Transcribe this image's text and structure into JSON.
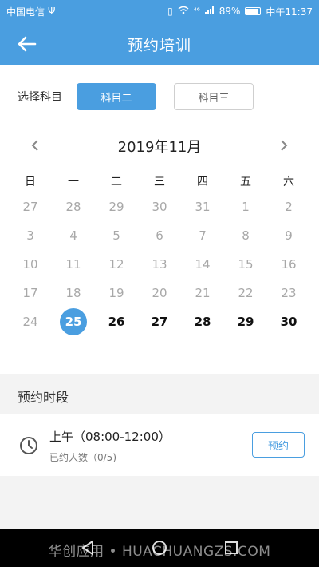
{
  "status_bar": {
    "carrier": "中国电信",
    "usb": "Ψ",
    "signal": "⁴⁶",
    "battery": "89%",
    "time": "中午11:37"
  },
  "header": {
    "title": "预约培训",
    "back_icon": "arrow-left-icon"
  },
  "subject": {
    "label": "选择科目",
    "options": [
      "科目二",
      "科目三"
    ],
    "selected": "科目二"
  },
  "calendar": {
    "month_title": "2019年11月",
    "weekdays": [
      "日",
      "一",
      "二",
      "三",
      "四",
      "五",
      "六"
    ],
    "weeks": [
      [
        "27",
        "28",
        "29",
        "30",
        "31",
        "1",
        "2"
      ],
      [
        "3",
        "4",
        "5",
        "6",
        "7",
        "8",
        "9"
      ],
      [
        "10",
        "11",
        "12",
        "13",
        "14",
        "15",
        "16"
      ],
      [
        "17",
        "18",
        "19",
        "20",
        "21",
        "22",
        "23"
      ],
      [
        "24",
        "25",
        "26",
        "27",
        "28",
        "29",
        "30"
      ]
    ],
    "selected_day": "25",
    "bookable_days": [
      "26",
      "27",
      "28",
      "29",
      "30"
    ]
  },
  "slots_section": {
    "title": "预约时段",
    "slots": [
      {
        "time": "上午（08:00-12:00）",
        "count": "已约人数（0/5)",
        "button": "预约"
      }
    ]
  },
  "watermark": "华创应用 • HUACHUANGZS.COM",
  "colors": {
    "primary": "#4a9ee0",
    "gray_text": "#a8a8a8",
    "background": "#f3f3f3"
  }
}
